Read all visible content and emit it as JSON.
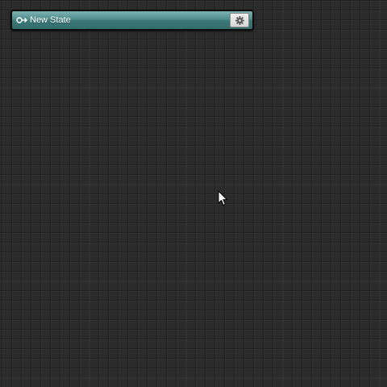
{
  "canvas": {
    "background_color": "#2b2b2b"
  },
  "state_node": {
    "label": "New State",
    "icon": "entry-arrow-icon",
    "settings_icon": "gear-icon",
    "color": "#4f8c8c"
  },
  "cursor": {
    "icon": "mouse-pointer-icon"
  }
}
